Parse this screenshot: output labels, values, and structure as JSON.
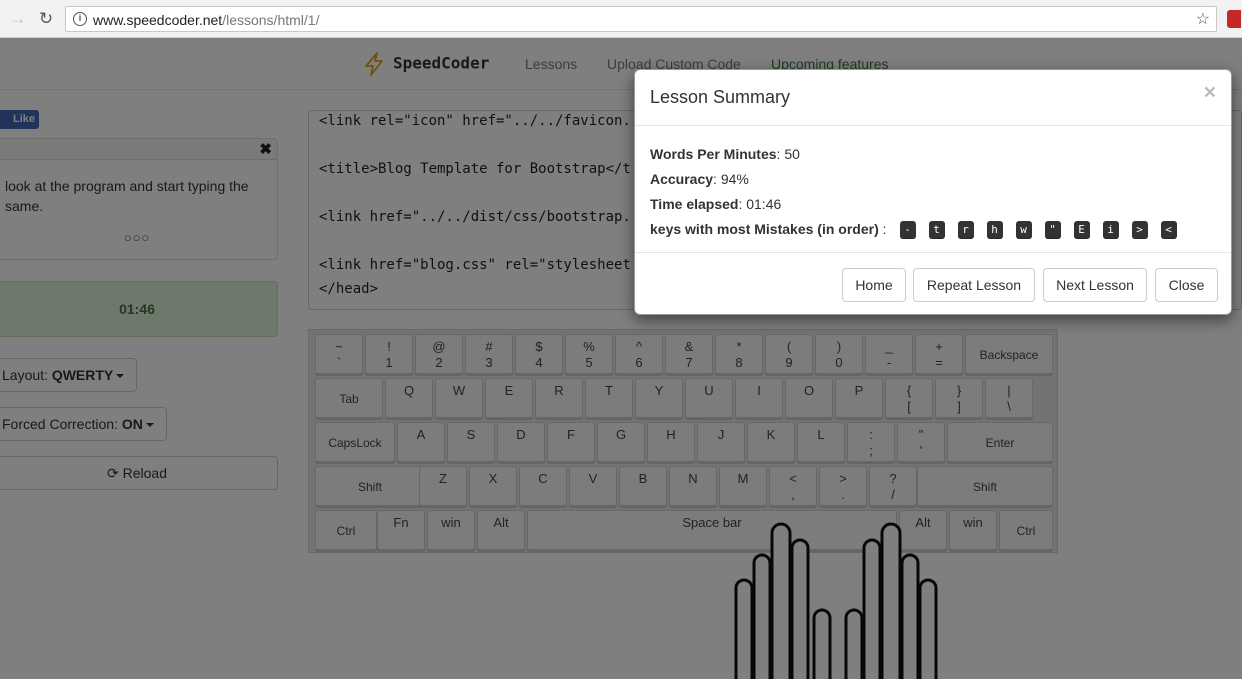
{
  "browser": {
    "url_host": "www.speedcoder.net",
    "url_path": "/lessons/html/1/"
  },
  "nav": {
    "brand": "SpeedCoder",
    "links": [
      "Lessons",
      "Upload Custom Code",
      "Upcoming features"
    ]
  },
  "sidebar": {
    "fb_like": "Like",
    "instructions": "look at the program and start typing the same.",
    "dots": "○○○",
    "timer": "01:46",
    "layout_label": "Layout: ",
    "layout_value": "QWERTY",
    "forced_label": "Forced Correction: ",
    "forced_value": "ON",
    "reload": "Reload"
  },
  "code_lines": [
    "<link rel=\"icon\" href=\"../../favicon.",
    "<title>Blog Template for Bootstrap</t",
    "<link href=\"../../dist/css/bootstrap.",
    "<link href=\"blog.css\" rel=\"stylesheet",
    "</head>"
  ],
  "keyboard": {
    "row1": [
      [
        "~",
        "`"
      ],
      [
        "!",
        "1"
      ],
      [
        "@",
        "2"
      ],
      [
        "#",
        "3"
      ],
      [
        "$",
        "4"
      ],
      [
        "%",
        "5"
      ],
      [
        "^",
        "6"
      ],
      [
        "&",
        "7"
      ],
      [
        "*",
        "8"
      ],
      [
        "(",
        "9"
      ],
      [
        ")",
        "0"
      ],
      [
        "_",
        "-"
      ],
      [
        "+",
        "="
      ]
    ],
    "backspace": "Backspace",
    "tab": "Tab",
    "row2": [
      "Q",
      "W",
      "E",
      "R",
      "T",
      "Y",
      "U",
      "I",
      "O",
      "P"
    ],
    "row2_sym": [
      [
        "{",
        "["
      ],
      [
        "}",
        "]"
      ],
      [
        "|",
        "\\"
      ]
    ],
    "capslock": "CapsLock",
    "row3": [
      "A",
      "S",
      "D",
      "F",
      "G",
      "H",
      "J",
      "K",
      "L"
    ],
    "row3_sym": [
      [
        ":",
        ";"
      ],
      [
        "\"",
        "'"
      ]
    ],
    "enter": "Enter",
    "shift": "Shift",
    "row4": [
      "Z",
      "X",
      "C",
      "V",
      "B",
      "N",
      "M"
    ],
    "row4_sym": [
      [
        "<",
        ","
      ],
      [
        ">",
        "."
      ],
      [
        "?",
        "/"
      ]
    ],
    "ctrl": "Ctrl",
    "fn": "Fn",
    "win": "win",
    "alt": "Alt",
    "space": "Space bar"
  },
  "modal": {
    "title": "Lesson Summary",
    "close_x": "×",
    "wpm_label": "Words Per Minutes",
    "wpm_value": ": 50",
    "accuracy_label": "Accuracy",
    "accuracy_value": ": 94%",
    "time_label": "Time elapsed",
    "time_value": ": 01:46",
    "mistakes_label": "keys with most Mistakes (in order)",
    "mistakes_sep": " :",
    "mistake_keys": [
      "-",
      "t",
      "r",
      "h",
      "w",
      "\"",
      "E",
      "i",
      ">",
      "<"
    ],
    "buttons": {
      "home": "Home",
      "repeat": "Repeat Lesson",
      "next": "Next Lesson",
      "close": "Close"
    }
  }
}
